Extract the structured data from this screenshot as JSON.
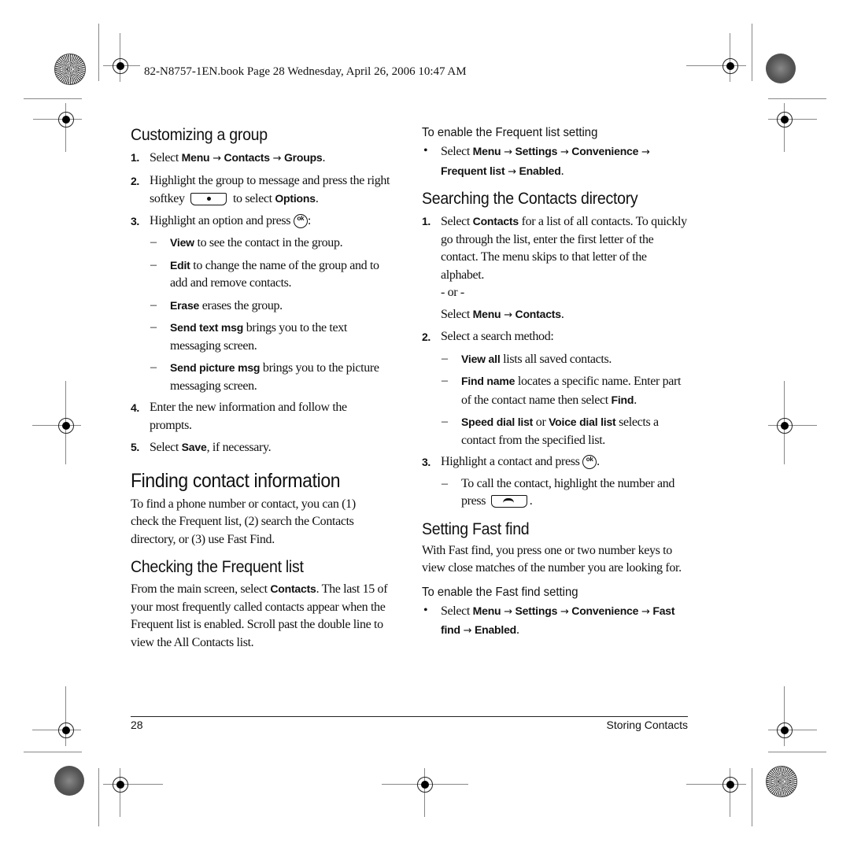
{
  "header": {
    "print_slug": "82-N8757-1EN.book  Page 28  Wednesday, April 26, 2006  10:47 AM"
  },
  "left": {
    "customizing": {
      "title": "Customizing a group",
      "step1": {
        "num": "1.",
        "pre": "Select ",
        "menu": "Menu",
        "arrow": " → ",
        "contacts": "Contacts",
        "arrow2": " → ",
        "groups": "Groups",
        "post": "."
      },
      "step2": {
        "num": "2.",
        "text": "Highlight the group to message and press the right softkey",
        "mid": " to select ",
        "options": "Options",
        "post": "."
      },
      "step3": {
        "num": "3.",
        "text": "Highlight an option and press ",
        "post": ":"
      },
      "options": [
        {
          "label": "View",
          "desc": " to see the contact in the group."
        },
        {
          "label": "Edit",
          "desc": " to change the name of the group and to add and remove contacts."
        },
        {
          "label": "Erase",
          "desc": " erases the group."
        },
        {
          "label": "Send text msg",
          "desc": " brings you to the text messaging screen."
        },
        {
          "label": "Send picture msg",
          "desc": " brings you to the picture messaging screen."
        }
      ],
      "step4": {
        "num": "4.",
        "text": "Enter the new information and follow the prompts."
      },
      "step5": {
        "num": "5.",
        "pre": "Select ",
        "save": "Save",
        "post": ", if necessary."
      }
    },
    "finding": {
      "title": "Finding contact information",
      "intro": "To find a phone number or contact, you can (1) check the Frequent list, (2) search the Contacts directory, or (3) use Fast Find."
    },
    "checking": {
      "title": "Checking the Frequent list",
      "pre": "From the main screen, select ",
      "contacts": "Contacts",
      "post": ". The last 15 of your most frequently called contacts appear when the Frequent list is enabled. Scroll past the double line to view the All Contacts list."
    }
  },
  "right": {
    "enable_frequent": {
      "title": "To enable the Frequent list setting",
      "bullet": "•",
      "pre": "Select ",
      "path": [
        "Menu",
        "Settings",
        "Convenience",
        "Frequent list",
        "Enabled"
      ],
      "arrow": " → ",
      "post": "."
    },
    "searching": {
      "title": "Searching the Contacts directory",
      "step1": {
        "num": "1.",
        "pre": "Select ",
        "contacts": "Contacts",
        "post": " for a list of all contacts. To quickly go through the list, enter the first letter of the contact. The menu skips to that letter of the alphabet."
      },
      "or": "- or -",
      "alt": {
        "pre": "Select ",
        "menu": "Menu",
        "arrow": " → ",
        "contacts": "Contacts",
        "post": "."
      },
      "step2": {
        "num": "2.",
        "text": "Select a search method:"
      },
      "methods": [
        {
          "label": "View all",
          "desc": " lists all saved contacts."
        },
        {
          "label": "Find name",
          "desc": " locates a specific name. Enter part of the contact name then select ",
          "find": "Find",
          "post": "."
        },
        {
          "label": "Speed dial list",
          "or": " or ",
          "label2": "Voice dial list",
          "desc": " selects a contact from the specified list."
        }
      ],
      "step3": {
        "num": "3.",
        "text": "Highlight a contact and press ",
        "post": "."
      },
      "call": {
        "text": "To call the contact, highlight the number and press ",
        "post": "."
      }
    },
    "fastfind": {
      "title": "Setting Fast find",
      "intro": "With Fast find, you press one or two number keys to view close matches of the number you are looking for."
    },
    "enable_fastfind": {
      "title": "To enable the Fast find setting",
      "bullet": "•",
      "pre": "Select ",
      "path": [
        "Menu",
        "Settings",
        "Convenience",
        "Fast find",
        "Enabled"
      ],
      "arrow": " → ",
      "post": "."
    }
  },
  "icons": {
    "ok_label": "ok"
  },
  "footer": {
    "page_number": "28",
    "section": "Storing Contacts"
  }
}
